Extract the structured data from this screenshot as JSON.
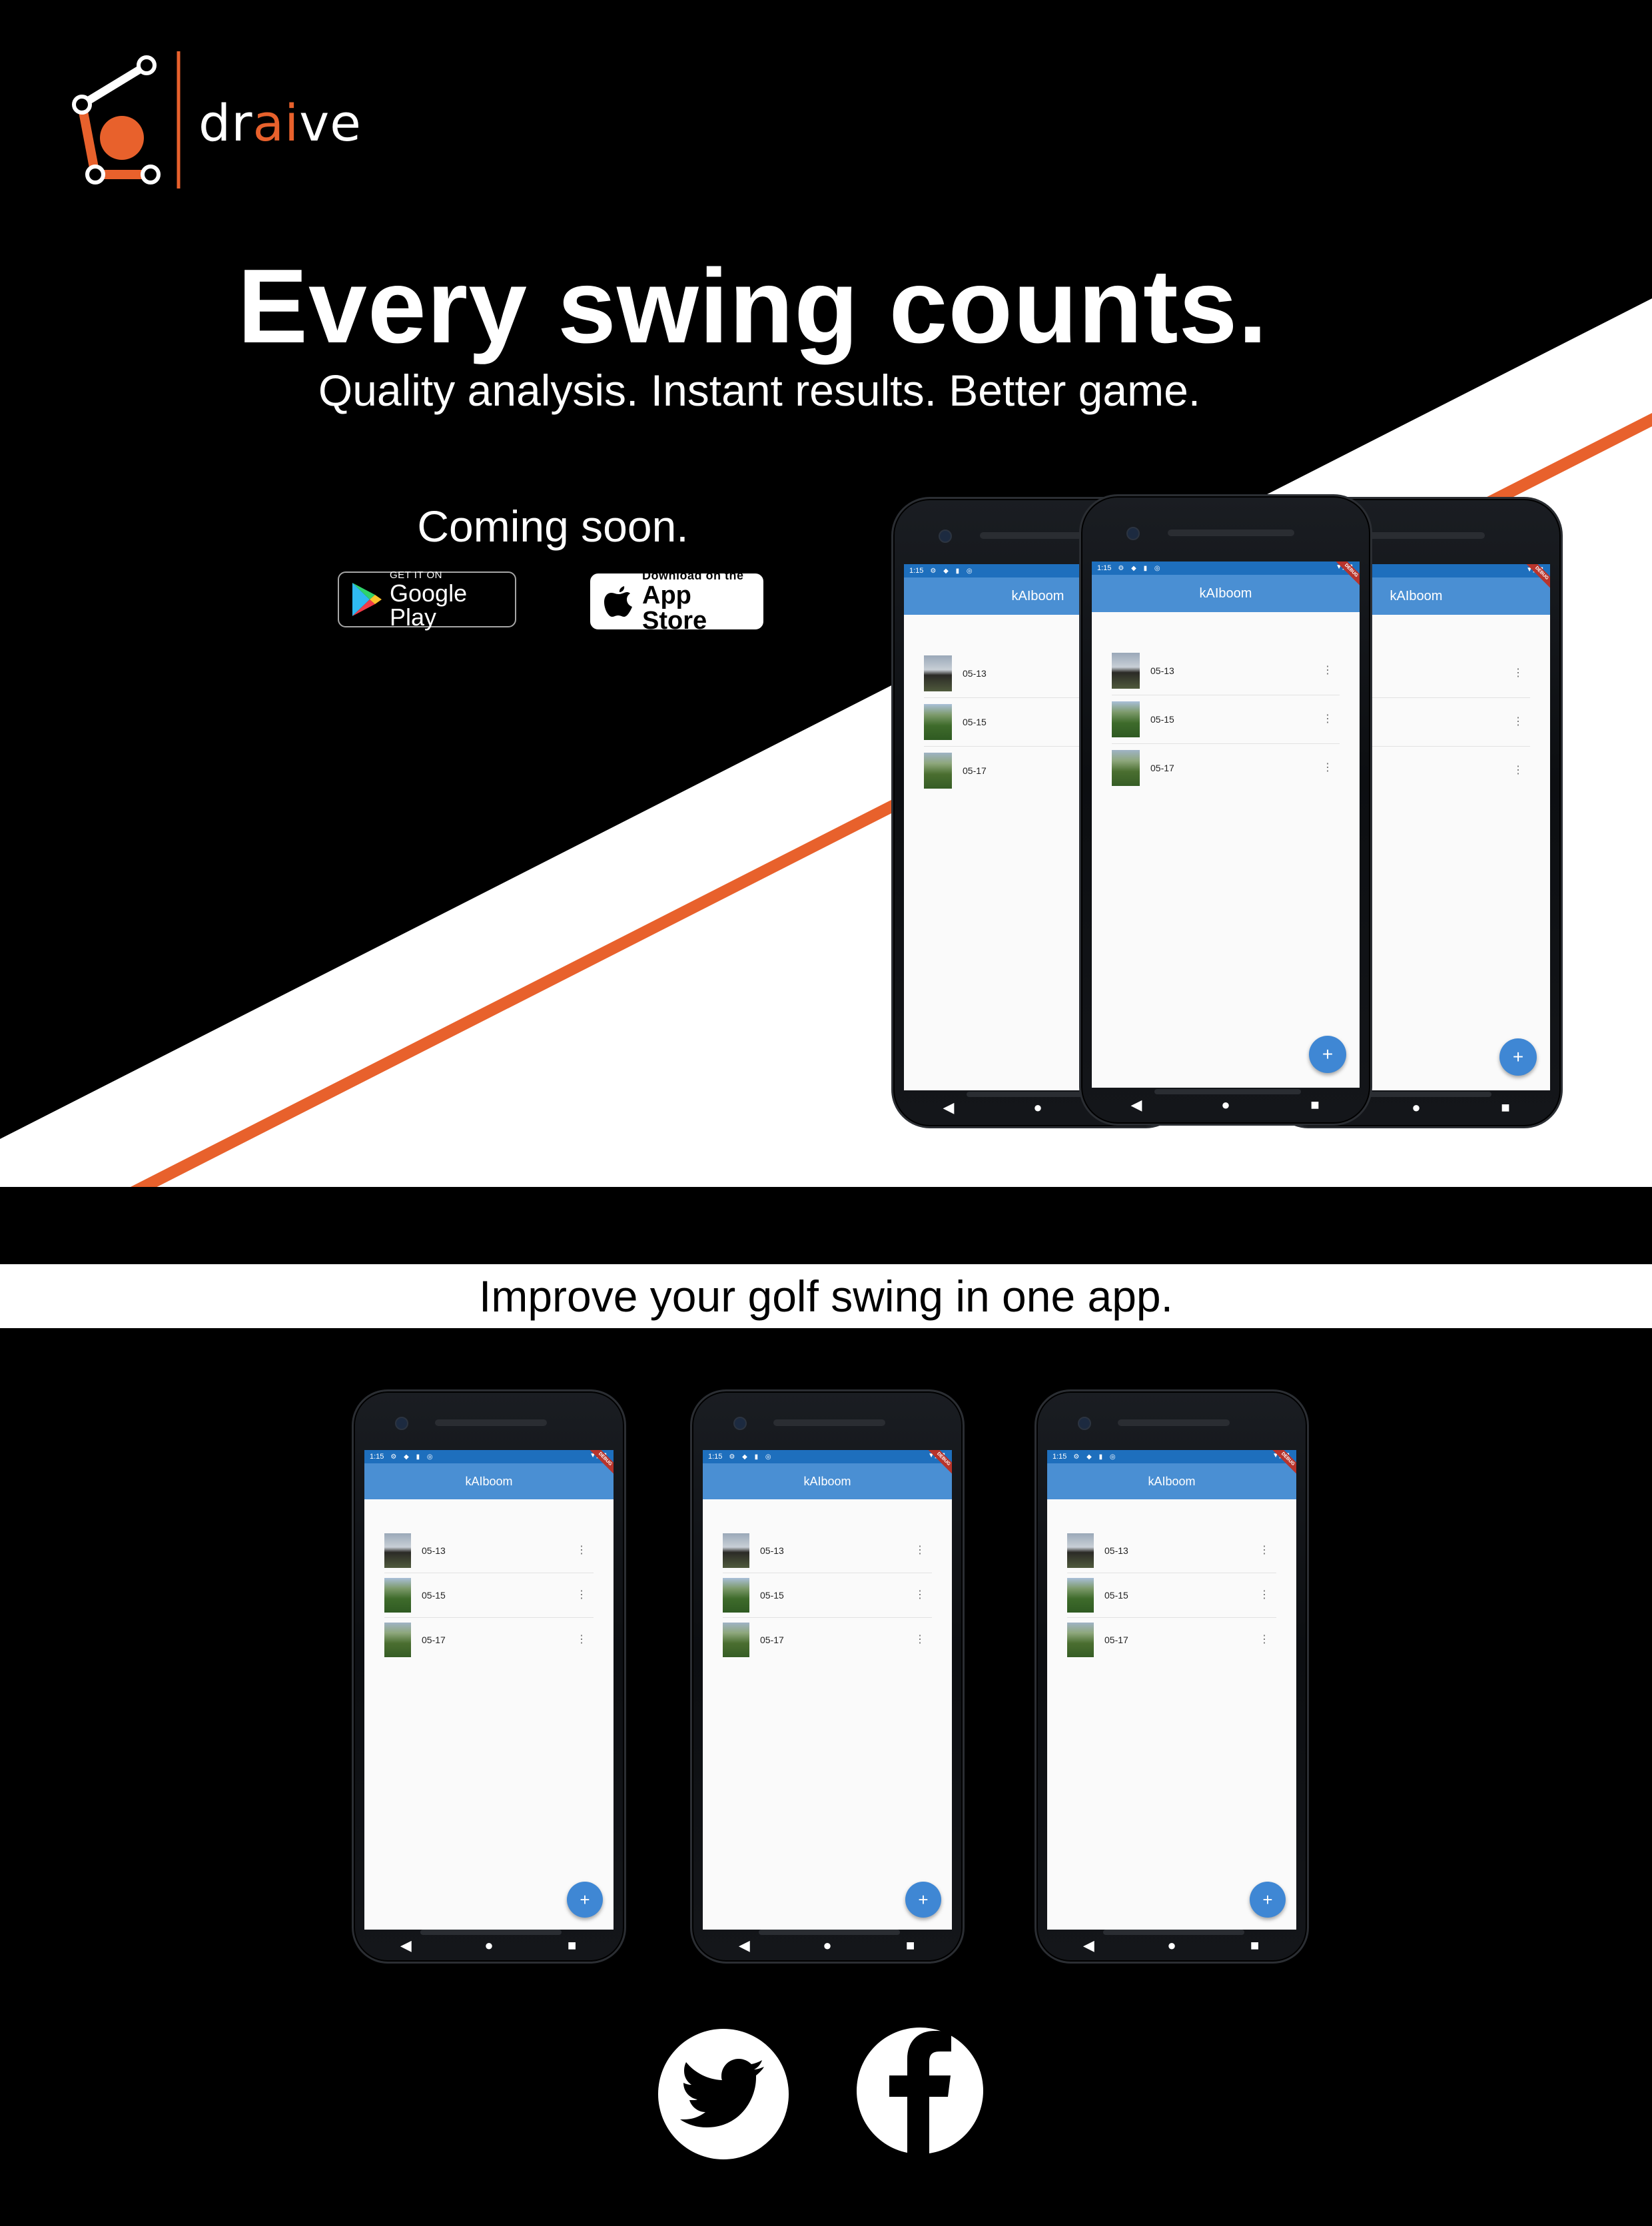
{
  "brand": {
    "name_prefix": "dr",
    "name_accent": "ai",
    "name_suffix": "ve",
    "accent_color": "#e8612c"
  },
  "hero": {
    "headline": "Every swing counts.",
    "subheadline": "Quality analysis. Instant results. Better game.",
    "coming_soon": "Coming soon."
  },
  "badges": {
    "google_play": {
      "small": "GET IT ON",
      "big": "Google Play",
      "icon": "google-play-icon"
    },
    "app_store": {
      "small": "Download on the",
      "big": "App Store",
      "icon": "apple-icon"
    }
  },
  "app_screen": {
    "status_time": "1:15",
    "debug_label": "DEBUG",
    "title": "kAIboom",
    "items": [
      {
        "label": "05-13"
      },
      {
        "label": "05-15"
      },
      {
        "label": "05-17"
      }
    ],
    "fab_label": "+",
    "nav": {
      "back": "◀",
      "home": "●",
      "recents": "■"
    },
    "theme_color": "#4a8fd3"
  },
  "section2": {
    "tagline": "Improve your golf swing in one app."
  },
  "social": [
    {
      "name": "twitter",
      "icon": "twitter-icon"
    },
    {
      "name": "facebook",
      "icon": "facebook-icon"
    }
  ]
}
